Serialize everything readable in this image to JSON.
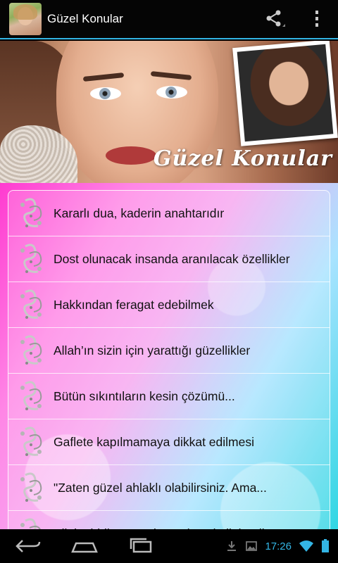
{
  "app": {
    "title": "Güzel Konular",
    "accent_color": "#33b5e5"
  },
  "action_bar": {
    "share_icon": "share-icon",
    "overflow_icon": "overflow-menu-icon"
  },
  "hero": {
    "caption": "Güzel Konular"
  },
  "list": {
    "items": [
      {
        "label": "Kararlı dua, kaderin anahtarıdır",
        "icon": "ornament-icon"
      },
      {
        "label": "Dost olunacak insanda aranılacak özellikler",
        "icon": "ornament-icon"
      },
      {
        "label": "Hakkından feragat edebilmek",
        "icon": "ornament-icon"
      },
      {
        "label": "Allah’ın sizin için yarattığı güzellikler",
        "icon": "ornament-icon"
      },
      {
        "label": "Bütün sıkıntıların kesin çözümü...",
        "icon": "ornament-icon"
      },
      {
        "label": "Gaflete kapılmamaya dikkat edilmesi",
        "icon": "ornament-icon"
      },
      {
        "label": "\"Zaten güzel ahlaklı olabilirsiniz. Ama...",
        "icon": "ornament-icon"
      },
      {
        "label": "Allah’ı iddia etmeyin, sadece kulluk edin",
        "icon": "ornament-icon"
      }
    ]
  },
  "navbar": {
    "back_icon": "back-icon",
    "home_icon": "home-icon",
    "recents_icon": "recent-apps-icon"
  },
  "status": {
    "time": "17:26",
    "download_icon": "download-icon",
    "image_icon": "image-notification-icon",
    "wifi_icon": "wifi-icon",
    "battery_icon": "battery-icon"
  }
}
